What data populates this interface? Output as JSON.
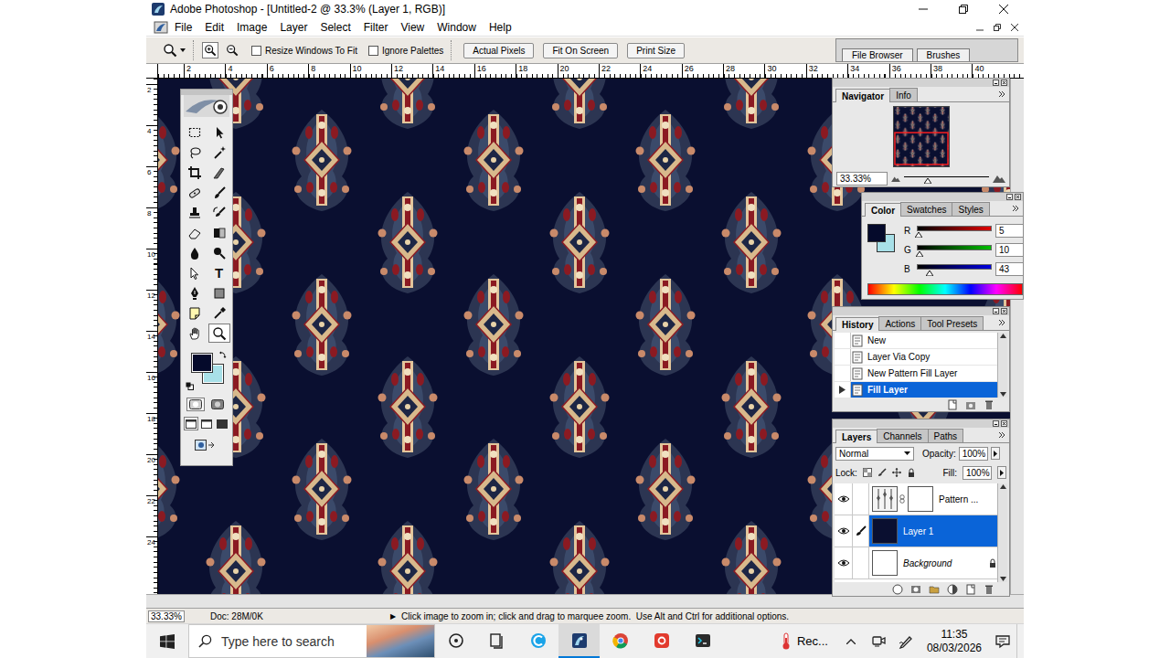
{
  "window": {
    "title": "Adobe Photoshop - [Untitled-2 @ 33.3% (Layer 1, RGB)]"
  },
  "menu": [
    "File",
    "Edit",
    "Image",
    "Layer",
    "Select",
    "Filter",
    "View",
    "Window",
    "Help"
  ],
  "options_bar": {
    "zoom_buttons": [
      {
        "kind": "zoom-in",
        "selected": true
      },
      {
        "kind": "zoom-out",
        "selected": false
      }
    ],
    "checkboxes": [
      {
        "label": "Resize Windows To Fit",
        "checked": false
      },
      {
        "label": "Ignore Palettes",
        "checked": false
      }
    ],
    "buttons": [
      "Actual Pixels",
      "Fit On Screen",
      "Print Size"
    ],
    "palette_well": [
      "File Browser",
      "Brushes"
    ]
  },
  "rulers": {
    "top": [
      "2",
      "4",
      "6",
      "8",
      "10",
      "12",
      "14",
      "16",
      "18",
      "20",
      "22",
      "24",
      "26",
      "28",
      "30",
      "32",
      "34",
      "36",
      "38",
      "40"
    ],
    "left": [
      "2",
      "4",
      "6",
      "8",
      "10",
      "12",
      "14",
      "16",
      "18",
      "20",
      "22",
      "24"
    ]
  },
  "toolbox": {
    "tools": [
      {
        "kind": "marquee",
        "selected": false
      },
      {
        "kind": "move",
        "selected": false
      },
      {
        "kind": "lasso",
        "selected": false
      },
      {
        "kind": "magic-wand",
        "selected": false
      },
      {
        "kind": "crop",
        "selected": false
      },
      {
        "kind": "slice",
        "selected": false
      },
      {
        "kind": "healing",
        "selected": false
      },
      {
        "kind": "brush",
        "selected": false
      },
      {
        "kind": "stamp",
        "selected": false
      },
      {
        "kind": "history-brush",
        "selected": false
      },
      {
        "kind": "eraser",
        "selected": false
      },
      {
        "kind": "gradient",
        "selected": false
      },
      {
        "kind": "blur",
        "selected": false
      },
      {
        "kind": "dodge",
        "selected": false
      },
      {
        "kind": "path-select",
        "selected": false
      },
      {
        "kind": "type",
        "selected": false,
        "glyph": "T"
      },
      {
        "kind": "pen",
        "selected": false
      },
      {
        "kind": "shape",
        "selected": false
      },
      {
        "kind": "notes",
        "selected": false
      },
      {
        "kind": "eyedropper",
        "selected": false
      },
      {
        "kind": "hand",
        "selected": false
      },
      {
        "kind": "zoom",
        "selected": true
      }
    ],
    "foreground": "#050a2b",
    "background": "#a8e0e8",
    "modes": [
      {
        "kind": "standard",
        "selected": true
      },
      {
        "kind": "quick-mask",
        "selected": false
      }
    ],
    "screen_modes": [
      {
        "kind": "standard-window",
        "selected": true
      },
      {
        "kind": "full-menu",
        "selected": false
      },
      {
        "kind": "full-screen",
        "selected": false
      }
    ]
  },
  "navigator": {
    "tabs": [
      {
        "label": "Navigator",
        "selected": true
      },
      {
        "label": "Info",
        "selected": false
      }
    ],
    "zoom": "33.33%",
    "level": 0.28
  },
  "color": {
    "tabs": [
      {
        "label": "Color",
        "selected": true
      },
      {
        "label": "Swatches",
        "selected": false
      },
      {
        "label": "Styles",
        "selected": false
      }
    ],
    "channels": [
      {
        "name": "R",
        "value": "5",
        "level": 0.02,
        "color": "#e00000"
      },
      {
        "name": "G",
        "value": "10",
        "level": 0.04,
        "color": "#00c000"
      },
      {
        "name": "B",
        "value": "43",
        "level": 0.17,
        "color": "#0000e0"
      }
    ]
  },
  "history": {
    "tabs": [
      {
        "label": "History",
        "selected": true
      },
      {
        "label": "Actions",
        "selected": false
      },
      {
        "label": "Tool Presets",
        "selected": false
      }
    ],
    "items": [
      {
        "label": "New",
        "selected": false
      },
      {
        "label": "Layer Via Copy",
        "selected": false
      },
      {
        "label": "New Pattern Fill Layer",
        "selected": false
      },
      {
        "label": "Fill Layer",
        "selected": true
      }
    ]
  },
  "layers": {
    "tabs": [
      {
        "label": "Layers",
        "selected": true
      },
      {
        "label": "Channels",
        "selected": false
      },
      {
        "label": "Paths",
        "selected": false
      }
    ],
    "blend_mode": "Normal",
    "opacity_label": "Opacity:",
    "opacity": "100%",
    "lock_label": "Lock:",
    "fill_label": "Fill:",
    "fill": "100%",
    "items": [
      {
        "name": "Pattern ...",
        "kind": "fill",
        "visible": true,
        "selected": false,
        "locked": false
      },
      {
        "name": "Layer 1",
        "kind": "pixel",
        "visible": true,
        "selected": true,
        "locked": false
      },
      {
        "name": "Background",
        "kind": "background",
        "visible": true,
        "selected": false,
        "locked": true
      }
    ]
  },
  "status_bar": {
    "zoom": "33.33%",
    "doc": "Doc: 28M/0K",
    "arrow": "▶",
    "hint": "Click image to zoom in; click and drag to marquee zoom.  Use Alt and Ctrl for additional options."
  },
  "taskbar": {
    "search_placeholder": "Type here to search",
    "apps": [
      {
        "kind": "task-view",
        "selected": false
      },
      {
        "kind": "timeline",
        "selected": false
      },
      {
        "kind": "copilot",
        "selected": false
      },
      {
        "kind": "photoshop",
        "selected": true
      },
      {
        "kind": "chrome",
        "selected": false
      },
      {
        "kind": "wps",
        "selected": false
      },
      {
        "kind": "terminal",
        "selected": false
      }
    ],
    "widget": "Rec...",
    "time": "11:35",
    "date": "08/03/2026"
  }
}
